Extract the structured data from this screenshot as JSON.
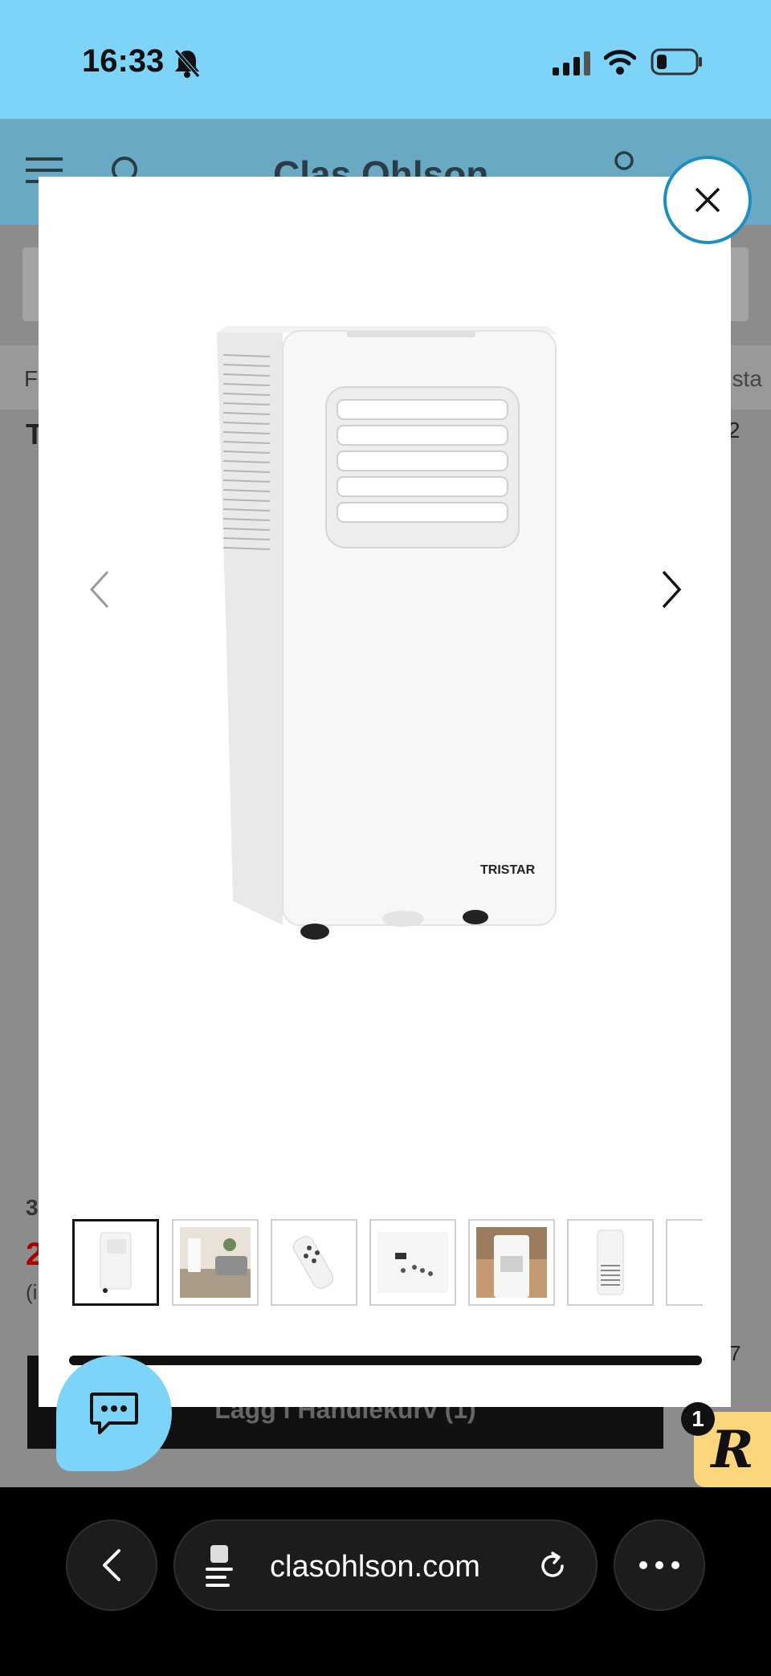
{
  "status_bar": {
    "time": "16:33"
  },
  "page": {
    "logo_text": "Clas Ohlson",
    "breadcrumb_left": "F",
    "breadcrumb_right": "rista",
    "title_fragment": "T",
    "rating_fragment": "2",
    "price_prefix": "3",
    "price_value": "2",
    "price_note": "(i",
    "count_fragment": "7",
    "cart_button_label": "Lägg i Handlekurv (1)"
  },
  "gallery": {
    "product_brand": "TRISTAR",
    "progress_fraction": 1.0,
    "thumbnails": [
      {
        "name": "thumb-front-unit",
        "active": true
      },
      {
        "name": "thumb-living-room",
        "active": false
      },
      {
        "name": "thumb-remote-control",
        "active": false
      },
      {
        "name": "thumb-control-panel",
        "active": false
      },
      {
        "name": "thumb-unit-in-room",
        "active": false
      },
      {
        "name": "thumb-rear-unit",
        "active": false
      },
      {
        "name": "thumb-partial",
        "active": false
      }
    ]
  },
  "rewards": {
    "badge_letter": "R",
    "count": "1"
  },
  "browser": {
    "url": "clasohlson.com"
  },
  "colors": {
    "accent_blue": "#7dd3f8",
    "close_border": "#1c8fc2",
    "reward_yellow": "#fbd67a"
  }
}
